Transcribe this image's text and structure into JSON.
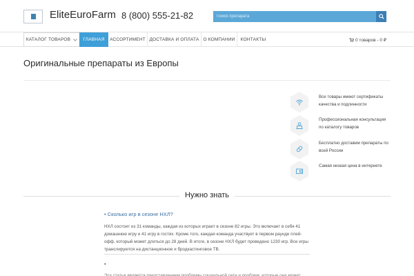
{
  "header": {
    "brand": "EliteEuroFarm",
    "phone": "8 (800) 555-21-82",
    "search_placeholder": "Поиск препарата"
  },
  "nav": {
    "catalog": "КАТАЛОГ ТОВАРОВ",
    "home": "ГЛАВНАЯ",
    "assortment": "АССОРТИМЕНТ",
    "delivery": "ДОСТАВКА И ОПЛАТА",
    "about": "О КОМПАНИИ",
    "contacts": "КОНТАКТЫ",
    "cart": "0 товаров - 0 ₽"
  },
  "page": {
    "title": "Оригинальные препараты из Европы"
  },
  "features": [
    {
      "icon": "wifi-icon",
      "text": "Все товары имеют сертификаты качества и подлинности"
    },
    {
      "icon": "consultant-icon",
      "text": "Профессиональная консультация по каталогу товаров"
    },
    {
      "icon": "pill-icon",
      "text": "Бесплатно доставим препараты по всей России"
    },
    {
      "icon": "wallet-icon",
      "text": "Самая низкая цена в интернете"
    }
  ],
  "faq": {
    "section_title": "Нужно знать",
    "q1": "• Сколько игр в сезоне НХЛ?",
    "a1": "НХЛ состоит из 31 команды, каждая из которых играет в сезоне 82 игры. Это включает в себя 41 домашнюю игру и 41 игру в гостях. Кроме того, каждая команда участвует в первом раунде плей-офф, который может длиться до 28 дней. В итоге, в сезоне НХЛ будет проведено 1230 игр. Все игры транслируются на дистанционное и бродкастинговое ТВ.",
    "q2": "•",
    "a2": "Эта статья является представлением проблемы социальной сети и проблем, которые она может"
  },
  "colors": {
    "accent": "#3f9fd8",
    "search_bg": "#5ba8d8",
    "search_btn": "#3c7fb3",
    "link": "#3a6fa5"
  }
}
